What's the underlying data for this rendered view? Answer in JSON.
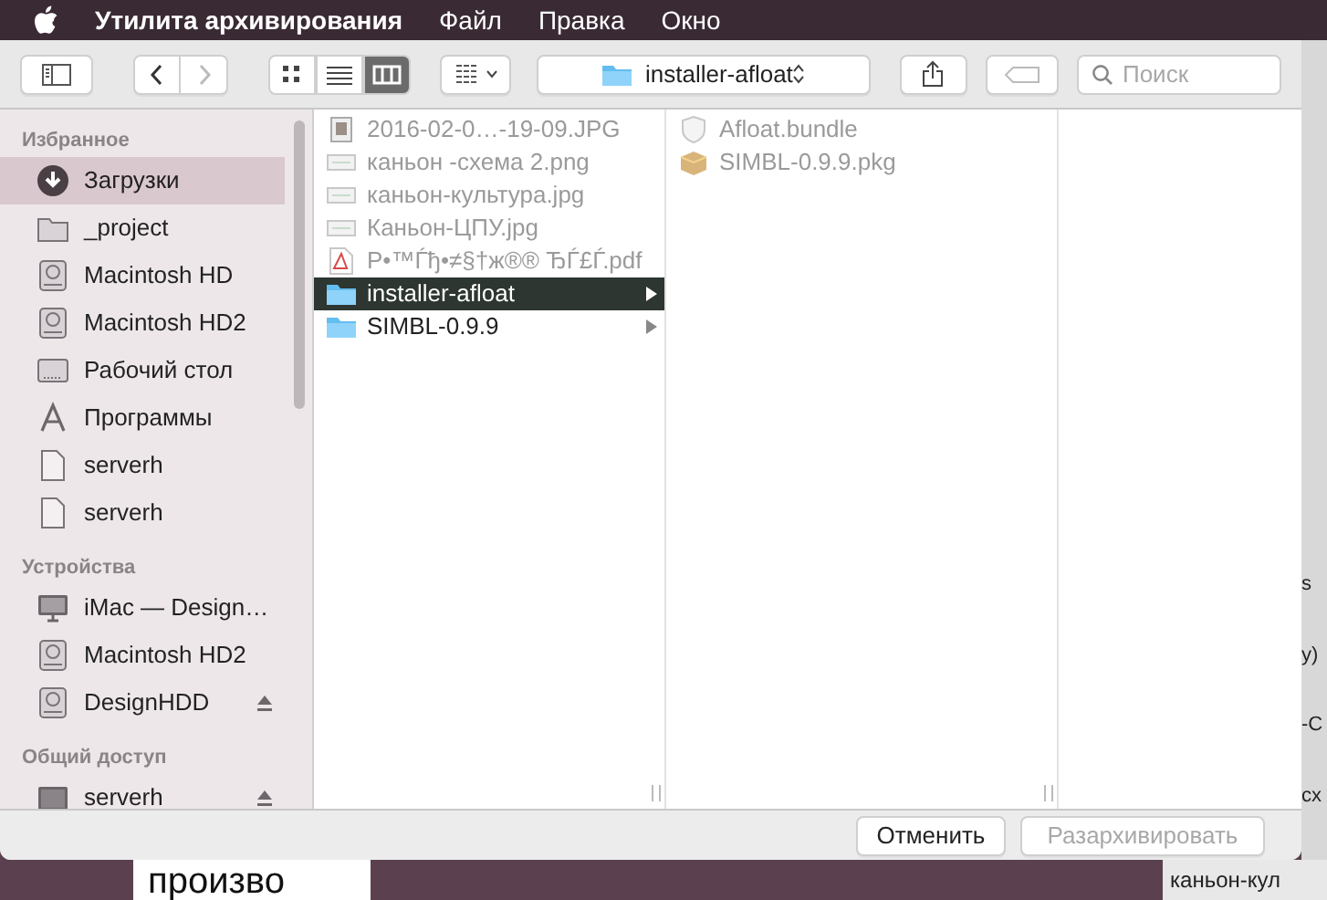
{
  "menu_bar": {
    "app_name": "Утилита архивирования",
    "items": [
      "Файл",
      "Правка",
      "Окно"
    ]
  },
  "toolbar": {
    "back_disabled": false,
    "forward_disabled": true,
    "views": [
      {
        "kind": "icons",
        "selected": false
      },
      {
        "kind": "list",
        "selected": false
      },
      {
        "kind": "columns",
        "selected": true
      }
    ],
    "path": "installer-afloat",
    "tag_disabled": true,
    "search": {
      "placeholder": "Поиск"
    }
  },
  "sidebar": {
    "sections": [
      {
        "title": "Избранное",
        "items": [
          {
            "kind": "download",
            "label": "Загрузки",
            "selected": true,
            "eject": false
          },
          {
            "kind": "folder",
            "label": "_project",
            "selected": false,
            "eject": false
          },
          {
            "kind": "disk",
            "label": "Macintosh HD",
            "selected": false,
            "eject": false
          },
          {
            "kind": "disk",
            "label": "Macintosh HD2",
            "selected": false,
            "eject": false
          },
          {
            "kind": "desktop",
            "label": "Рабочий стол",
            "selected": false,
            "eject": false
          },
          {
            "kind": "apps",
            "label": "Программы",
            "selected": false,
            "eject": false
          },
          {
            "kind": "file",
            "label": "serverh",
            "selected": false,
            "eject": false
          },
          {
            "kind": "file",
            "label": "serverh",
            "selected": false,
            "eject": false
          }
        ]
      },
      {
        "title": "Устройства",
        "items": [
          {
            "kind": "imac",
            "label": "iMac — Design…",
            "selected": false,
            "eject": false
          },
          {
            "kind": "disk",
            "label": "Macintosh HD2",
            "selected": false,
            "eject": false
          },
          {
            "kind": "disk",
            "label": "DesignHDD",
            "selected": false,
            "eject": true
          }
        ]
      },
      {
        "title": "Общий доступ",
        "items": [
          {
            "kind": "server",
            "label": "serverh",
            "selected": false,
            "eject": true
          }
        ]
      }
    ]
  },
  "columns": [
    {
      "items": [
        {
          "kind": "photo",
          "name": "2016-02-0…-19-09.JPG",
          "selected": false,
          "folder": false,
          "disabled": true
        },
        {
          "kind": "image",
          "name": "каньон -схема 2.png",
          "selected": false,
          "folder": false,
          "disabled": true
        },
        {
          "kind": "image",
          "name": "каньон-культура.jpg",
          "selected": false,
          "folder": false,
          "disabled": true
        },
        {
          "kind": "image",
          "name": "Каньон-ЦПУ.jpg",
          "selected": false,
          "folder": false,
          "disabled": true
        },
        {
          "kind": "pdf",
          "name": "Р•™Ѓђ•≠§†ж®® ЂЃ£Ѓ.pdf",
          "selected": false,
          "folder": false,
          "disabled": true
        },
        {
          "kind": "folder",
          "name": "installer-afloat",
          "selected": true,
          "folder": true,
          "disabled": false
        },
        {
          "kind": "folder",
          "name": "SIMBL-0.9.9",
          "selected": false,
          "folder": true,
          "disabled": false
        }
      ]
    },
    {
      "items": [
        {
          "kind": "bundle",
          "name": "Afloat.bundle",
          "selected": false,
          "folder": false,
          "disabled": true
        },
        {
          "kind": "package",
          "name": "SIMBL-0.9.9.pkg",
          "selected": false,
          "folder": false,
          "disabled": true
        }
      ]
    }
  ],
  "buttons": [
    {
      "label": "Отменить",
      "disabled": false
    },
    {
      "label": "Разархивировать",
      "disabled": true
    }
  ],
  "background": {
    "right_edge": [
      "s",
      "y)",
      "-С",
      "сх"
    ],
    "bottom_left": "произво",
    "bottom_right": "каньон-кул"
  }
}
